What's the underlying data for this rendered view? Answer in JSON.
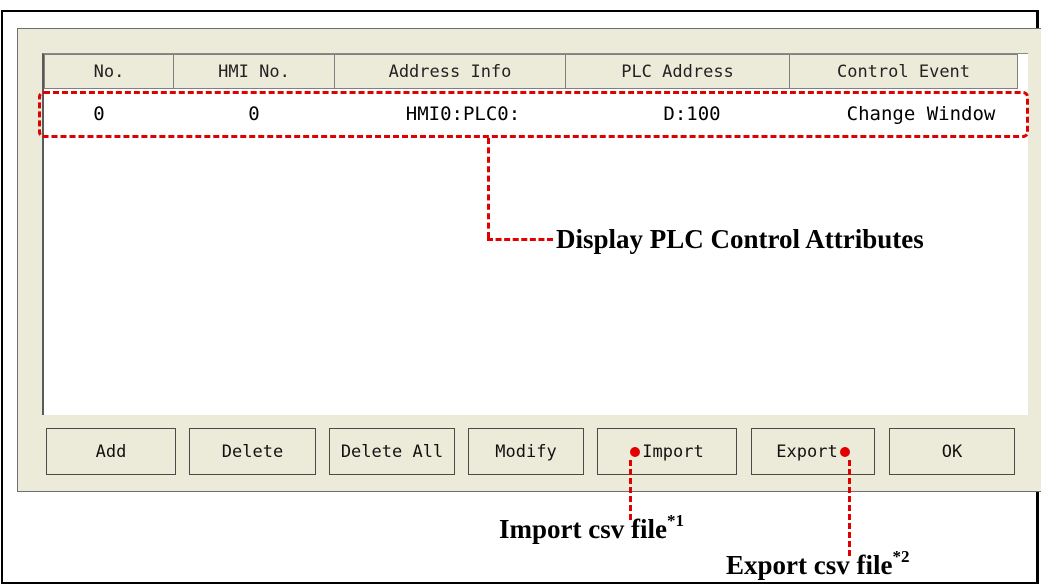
{
  "table": {
    "headers": [
      "No.",
      "HMI No.",
      "Address Info",
      "PLC Address",
      "Control Event"
    ],
    "rows": [
      [
        "0",
        "0",
        "HMI0:PLC0:",
        "D:100",
        "Change Window"
      ]
    ]
  },
  "buttons": {
    "add": "Add",
    "delete": "Delete",
    "delete_all": "Delete All",
    "modify": "Modify",
    "import": "Import",
    "export": "Export",
    "ok": "OK"
  },
  "annotations": {
    "display_attributes": "Display PLC Control Attributes",
    "import_csv": "Import csv file",
    "import_note": "*1",
    "export_csv": "Export csv file",
    "export_note": "*2"
  },
  "colors": {
    "dialog_bg": "#ecebd9",
    "annotation": "#e00000"
  }
}
